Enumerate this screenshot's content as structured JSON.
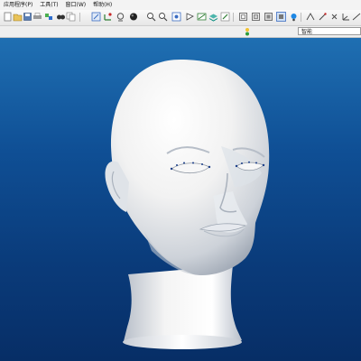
{
  "menu": {
    "items": [
      "应用程序(P)",
      "工具(T)",
      "窗口(W)",
      "帮助(H)"
    ]
  },
  "toolbar": {
    "buttons": [
      "new-icon",
      "open-icon",
      "save-icon",
      "print-icon",
      "regenerate-icon",
      "find-icon",
      "copy-icon",
      "repaint-icon",
      "orient-icon",
      "appearance-icon",
      "zoom-in-icon",
      "zoom-out-icon",
      "refit-icon",
      "datum-plane-icon",
      "datum-axis-icon",
      "layers-icon",
      "wireframe-icon",
      "hidden-line-icon",
      "no-hidden-icon",
      "shading-icon",
      "spin-center-icon",
      "sketch-icon",
      "point-icon",
      "axis-icon",
      "csys-icon"
    ]
  },
  "statusbar": {
    "filter_value": "智能",
    "indicator": "traffic-light-icon"
  },
  "viewport": {
    "model": "mannequin-head-model",
    "background_top": "#1f6fb2",
    "background_bottom": "#072e66"
  }
}
